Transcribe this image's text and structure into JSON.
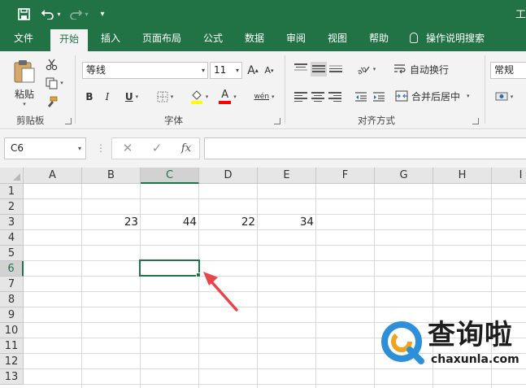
{
  "titlebar": {
    "title_fragment": "工",
    "customize_label": "▾"
  },
  "tabs": [
    {
      "label": "文件",
      "active": false
    },
    {
      "label": "开始",
      "active": true
    },
    {
      "label": "插入",
      "active": false
    },
    {
      "label": "页面布局",
      "active": false
    },
    {
      "label": "公式",
      "active": false
    },
    {
      "label": "数据",
      "active": false
    },
    {
      "label": "审阅",
      "active": false
    },
    {
      "label": "视图",
      "active": false
    },
    {
      "label": "帮助",
      "active": false
    }
  ],
  "tell_me": {
    "label": "操作说明搜索",
    "icon": "lightbulb-icon"
  },
  "ribbon": {
    "clipboard": {
      "group_label": "剪贴板",
      "paste_label": "粘贴",
      "paste_icon": "clipboard-icon",
      "cut_icon": "scissors-icon",
      "copy_icon": "copy-icon",
      "format_painter_icon": "brush-icon"
    },
    "font": {
      "group_label": "字体",
      "font_name": "等线",
      "font_size": "11",
      "grow_label": "A",
      "shrink_label": "A",
      "bold_label": "B",
      "italic_label": "I",
      "underline_label": "U",
      "font_color_label": "A",
      "phonetic_label": "wén",
      "fill_color": "#ffff00",
      "font_color": "#ff0000"
    },
    "alignment": {
      "group_label": "对齐方式",
      "wrap_label": "自动换行",
      "merge_label": "合并后居中"
    },
    "number": {
      "format": "常规"
    }
  },
  "formula_bar": {
    "name_box": "C6",
    "cancel_label": "✕",
    "enter_label": "✓",
    "fx_label": "fx",
    "value": ""
  },
  "sheet": {
    "columns": [
      "A",
      "B",
      "C",
      "D",
      "E",
      "F",
      "G",
      "H",
      "I"
    ],
    "rows": [
      "1",
      "2",
      "3",
      "4",
      "5",
      "6",
      "7",
      "8",
      "9",
      "10",
      "11",
      "12",
      "13"
    ],
    "selected_column": "C",
    "selected_row": "6",
    "cells": {
      "B3": "23",
      "C3": "44",
      "D3": "22",
      "E3": "34"
    }
  },
  "watermark": {
    "text": "查询啦",
    "sub": "chaxunla.com"
  },
  "colors": {
    "brand": "#217346",
    "arrow": "#e8454a"
  }
}
